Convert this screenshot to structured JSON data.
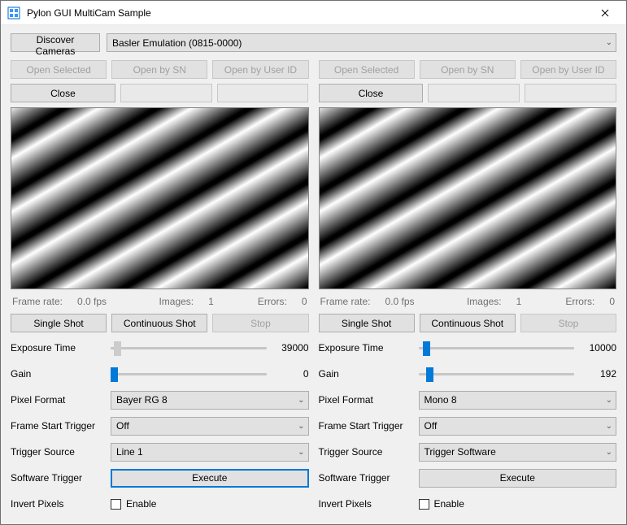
{
  "window": {
    "title": "Pylon GUI MultiCam Sample"
  },
  "top": {
    "discover_label": "Discover Cameras",
    "camera_combo": "Basler Emulation (0815-0000)"
  },
  "labels": {
    "open_selected": "Open Selected",
    "open_by_sn": "Open by SN",
    "open_by_user_id": "Open by User ID",
    "close": "Close",
    "single_shot": "Single Shot",
    "continuous_shot": "Continuous Shot",
    "stop": "Stop",
    "exposure_time": "Exposure Time",
    "gain": "Gain",
    "pixel_format": "Pixel Format",
    "frame_start_trigger": "Frame Start Trigger",
    "trigger_source": "Trigger Source",
    "software_trigger": "Software Trigger",
    "execute": "Execute",
    "invert_pixels": "Invert Pixels",
    "enable": "Enable",
    "frame_rate": "Frame rate:",
    "images": "Images:",
    "errors": "Errors:"
  },
  "panels": [
    {
      "status": {
        "frame_rate": "0.0 fps",
        "images": "1",
        "errors": "0"
      },
      "exposure": {
        "value": "39000",
        "pct": 2
      },
      "gain": {
        "value": "0",
        "pct": 0
      },
      "pixel_format": "Bayer RG 8",
      "frame_start_trigger": "Off",
      "trigger_source": "Line 1",
      "execute_focused": true
    },
    {
      "status": {
        "frame_rate": "0.0 fps",
        "images": "1",
        "errors": "0"
      },
      "exposure": {
        "value": "10000",
        "pct": 3
      },
      "gain": {
        "value": "192",
        "pct": 5
      },
      "pixel_format": "Mono 8",
      "frame_start_trigger": "Off",
      "trigger_source": "Trigger Software",
      "execute_focused": false
    }
  ]
}
